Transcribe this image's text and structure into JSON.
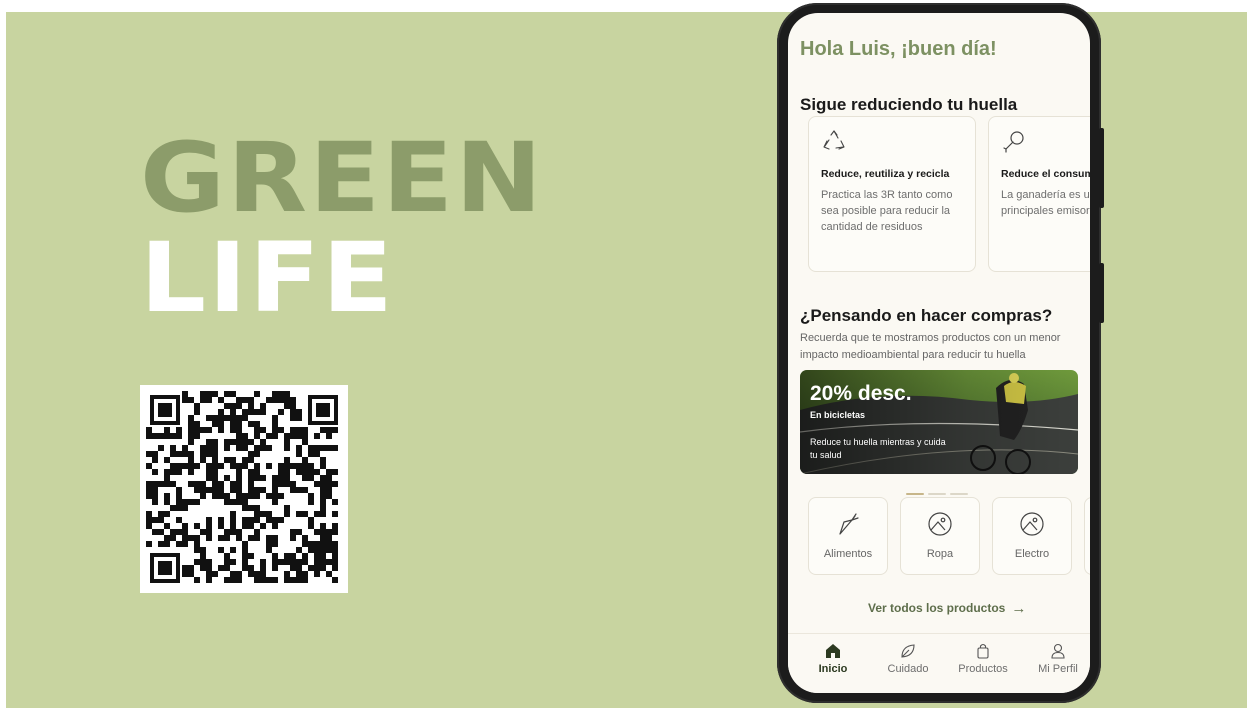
{
  "brand": {
    "line1": "GREEN",
    "line2": "LIFE"
  },
  "colors": {
    "background": "#c8d4a0",
    "brand_dark": "#8c9c6a",
    "greeting": "#7d9162",
    "screen_bg": "#fbf9f3",
    "nav_active": "#2c3a20"
  },
  "qr": {
    "icon": "qr-code"
  },
  "app": {
    "greeting": "Hola Luis, ¡buen día!",
    "section1_title": "Sigue reduciendo tu huella",
    "tips": [
      {
        "icon": "recycle-icon",
        "title": "Reduce, reutiliza y recicla",
        "desc": "Practica las 3R tanto como sea posible para reducir la cantidad de residuos"
      },
      {
        "icon": "drumstick-icon",
        "title": "Reduce el consumo de carne",
        "desc": "La ganadería es uno de los principales emisores de GEI"
      }
    ],
    "section2_title": "¿Pensando en hacer compras?",
    "section2_desc": "Recuerda que te mostramos productos con un menor impacto medioambiental para reducir tu huella",
    "banner": {
      "headline": "20% desc.",
      "subtitle": "En bicicletas",
      "desc": "Reduce tu huella mientras y cuida tu salud"
    },
    "carousel": {
      "pages": 3,
      "active": 0
    },
    "categories": [
      {
        "icon": "carrot-icon",
        "label": "Alimentos"
      },
      {
        "icon": "image-icon",
        "label": "Ropa"
      },
      {
        "icon": "image-icon",
        "label": "Electro"
      }
    ],
    "see_all": "Ver todos los productos",
    "nav": [
      {
        "icon": "home-icon",
        "label": "Inicio",
        "active": true
      },
      {
        "icon": "leaf-icon",
        "label": "Cuidado",
        "active": false
      },
      {
        "icon": "bag-icon",
        "label": "Productos",
        "active": false
      },
      {
        "icon": "user-icon",
        "label": "Mi Perfil",
        "active": false
      }
    ]
  }
}
